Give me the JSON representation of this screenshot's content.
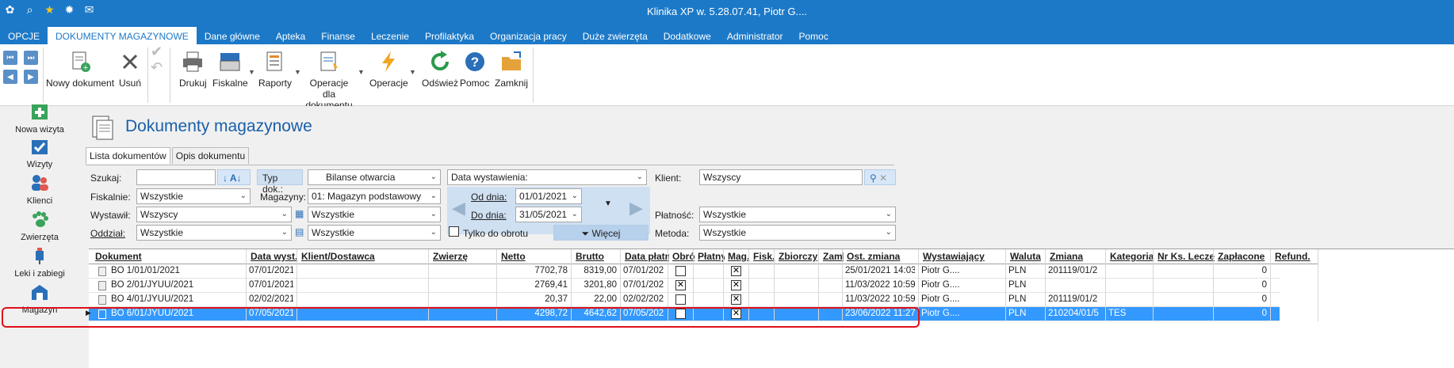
{
  "app": {
    "title": "Klinika XP w. 5.28.07.41, Piotr G...."
  },
  "menu": {
    "items": [
      "OPCJE",
      "DOKUMENTY MAGAZYNOWE",
      "Dane główne",
      "Apteka",
      "Finanse",
      "Leczenie",
      "Profilaktyka",
      "Organizacja pracy",
      "Duże zwierzęta",
      "Dodatkowe",
      "Administrator",
      "Pomoc"
    ],
    "active": "DOKUMENTY MAGAZYNOWE"
  },
  "ribbon": {
    "new_doc": "Nowy dokument",
    "delete": "Usuń",
    "print": "Drukuj",
    "fiscal": "Fiskalne",
    "reports": "Raporty",
    "doc_ops": "Operacje dla dokumentu",
    "ops": "Operacje",
    "refresh": "Odśwież",
    "help": "Pomoc",
    "close": "Zamknij"
  },
  "sidebar": {
    "items": [
      "Nowa wizyta",
      "Wizyty",
      "Klienci",
      "Zwierzęta",
      "Leki i zabiegi",
      "Magazyn"
    ]
  },
  "page": {
    "title": "Dokumenty magazynowe",
    "tabs": [
      "Lista dokumentów",
      "Opis dokumentu"
    ]
  },
  "filters": {
    "search_label": "Szukaj:",
    "search_value": "",
    "doc_type_label": "Typ dok.:",
    "doc_type_value": "Bilanse otwarcia",
    "date_field_value": "Data wystawienia:",
    "client_label": "Klient:",
    "client_value": "Wszyscy",
    "fiscal_label": "Fiskalnie:",
    "fiscal_value": "Wszystkie",
    "warehouse_label": "Magazyny:",
    "warehouse_value": "01: Magazyn podstawowy",
    "from_label": "Od dnia:",
    "from_value": "01/01/2021",
    "to_label": "Do dnia:",
    "to_value": "31/05/2021",
    "issued_by_label": "Wystawił:",
    "issued_by_value": "Wszyscy",
    "filter2_value": "Wszystkie",
    "payment_label": "Płatność:",
    "payment_value": "Wszystkie",
    "branch_label": "Oddział:",
    "branch_value": "Wszystkie",
    "filter3_value": "Wszystkie",
    "turnover_only": "Tylko do obrotu",
    "more_button": "Więcej",
    "method_label": "Metoda:",
    "method_value": "Wszystkie"
  },
  "table": {
    "columns": [
      "Dokument",
      "Data wyst.",
      "Klient/Dostawca",
      "Zwierzę",
      "Netto",
      "Brutto",
      "Data płatn.",
      "Obrót",
      "Płatny",
      "Mag.",
      "Fisk.",
      "Zbiorczy",
      "Zamk",
      "Ost. zmiana",
      "Wystawiający",
      "Waluta",
      "Zmiana",
      "Kategoria",
      "Nr Ks. Leczenia",
      "Zapłacone",
      "Refund."
    ],
    "rows": [
      {
        "doc": "BO 1/01/01/2021",
        "date": "07/01/2021",
        "client": "",
        "animal": "",
        "netto": "7702,78",
        "brutto": "8319,00",
        "paydate": "07/01/2021",
        "obrot": false,
        "mag": true,
        "last": "25/01/2021 14:03",
        "issuer": "Piotr G....",
        "cur": "PLN",
        "change": "201119/01/2",
        "cat": "",
        "paid": "0",
        "selected": false
      },
      {
        "doc": "BO 2/01/JYUU/2021",
        "date": "07/01/2021",
        "client": "",
        "animal": "",
        "netto": "2769,41",
        "brutto": "3201,80",
        "paydate": "07/01/2021",
        "obrot": true,
        "mag": true,
        "last": "11/03/2022 10:59",
        "issuer": "Piotr G....",
        "cur": "PLN",
        "change": "",
        "cat": "",
        "paid": "0",
        "selected": false
      },
      {
        "doc": "BO 4/01/JYUU/2021",
        "date": "02/02/2021",
        "client": "",
        "animal": "",
        "netto": "20,37",
        "brutto": "22,00",
        "paydate": "02/02/2021",
        "obrot": false,
        "mag": true,
        "last": "11/03/2022 10:59",
        "issuer": "Piotr G....",
        "cur": "PLN",
        "change": "201119/01/2",
        "cat": "",
        "paid": "0",
        "selected": false
      },
      {
        "doc": "BO 6/01/JYUU/2021",
        "date": "07/05/2021",
        "client": "",
        "animal": "",
        "netto": "4298,72",
        "brutto": "4642,62",
        "paydate": "07/05/2021",
        "obrot": false,
        "mag": true,
        "last": "23/06/2022 11:27",
        "issuer": "Piotr G....",
        "cur": "PLN",
        "change": "210204/01/5",
        "cat": "TES",
        "paid": "0",
        "selected": true
      }
    ]
  }
}
